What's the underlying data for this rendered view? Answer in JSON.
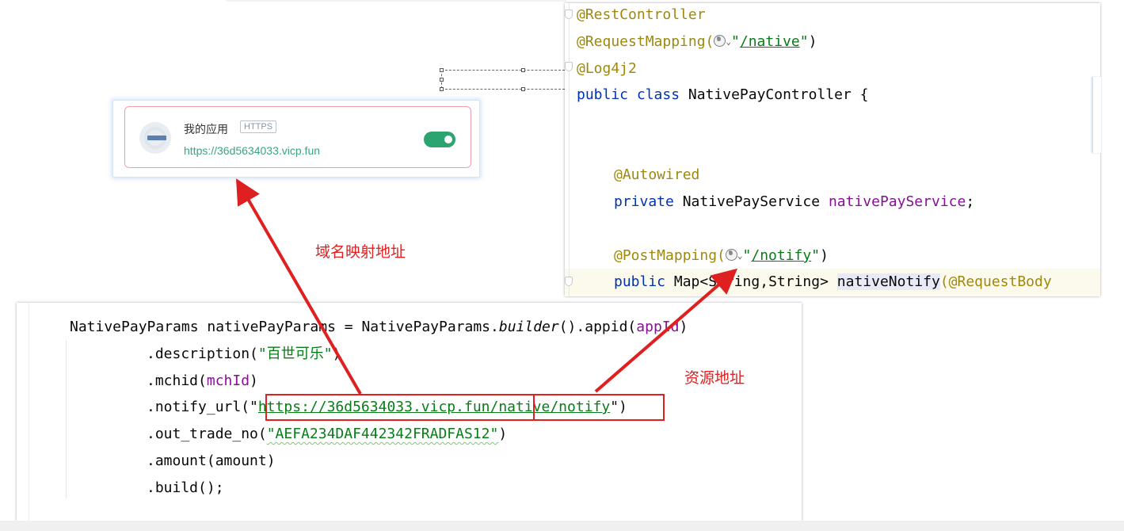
{
  "app_card": {
    "name": "我的应用",
    "badge": "HTTPS",
    "url": "https://36d5634033.vicp.fun",
    "toggle_on": true
  },
  "annotations": {
    "domain_label": "域名映射地址",
    "resource_label": "资源地址",
    "color": "#e02020"
  },
  "controller_code": {
    "l1": "@RestController",
    "l2_pre": "@RequestMapping(",
    "l2_path": "/native",
    "l2_post": "\")",
    "l3": "@Log4j2",
    "l4_kw": "public class ",
    "l4_name": "NativePayController {",
    "l5": "@Autowired",
    "l6_kw": "private ",
    "l6_type": "NativePayService ",
    "l6_field": "nativePayService",
    "l7_pre": "@PostMapping(",
    "l7_path": "/notify",
    "l7_post": "\")",
    "l8_kw": "public ",
    "l8_type": "Map<String,String> ",
    "l8_method": "nativeNotify",
    "l8_ann": "(@RequestBody"
  },
  "builder_code": {
    "b1_a": "NativePayParams nativePayParams = NativePayParams.",
    "b1_b": "builder",
    "b1_c": "().appid(",
    "b1_d": "appId",
    "b2_a": ".description(",
    "b2_s": "\"百世可乐\"",
    "b3_a": ".mchid(",
    "b3_f": "mchId",
    "b4_a": ".notify_url(\"",
    "b4_host": "https://36d5634033.vicp.fun/",
    "b4_path": "native/notify",
    "b4_end": "\")",
    "b5_a": ".out_trade_no(",
    "b5_s": "\"AEFA234DAF442342FRADFAS12\"",
    "b5_end": ")",
    "b6": ".amount(amount)",
    "b7": ".build();"
  }
}
